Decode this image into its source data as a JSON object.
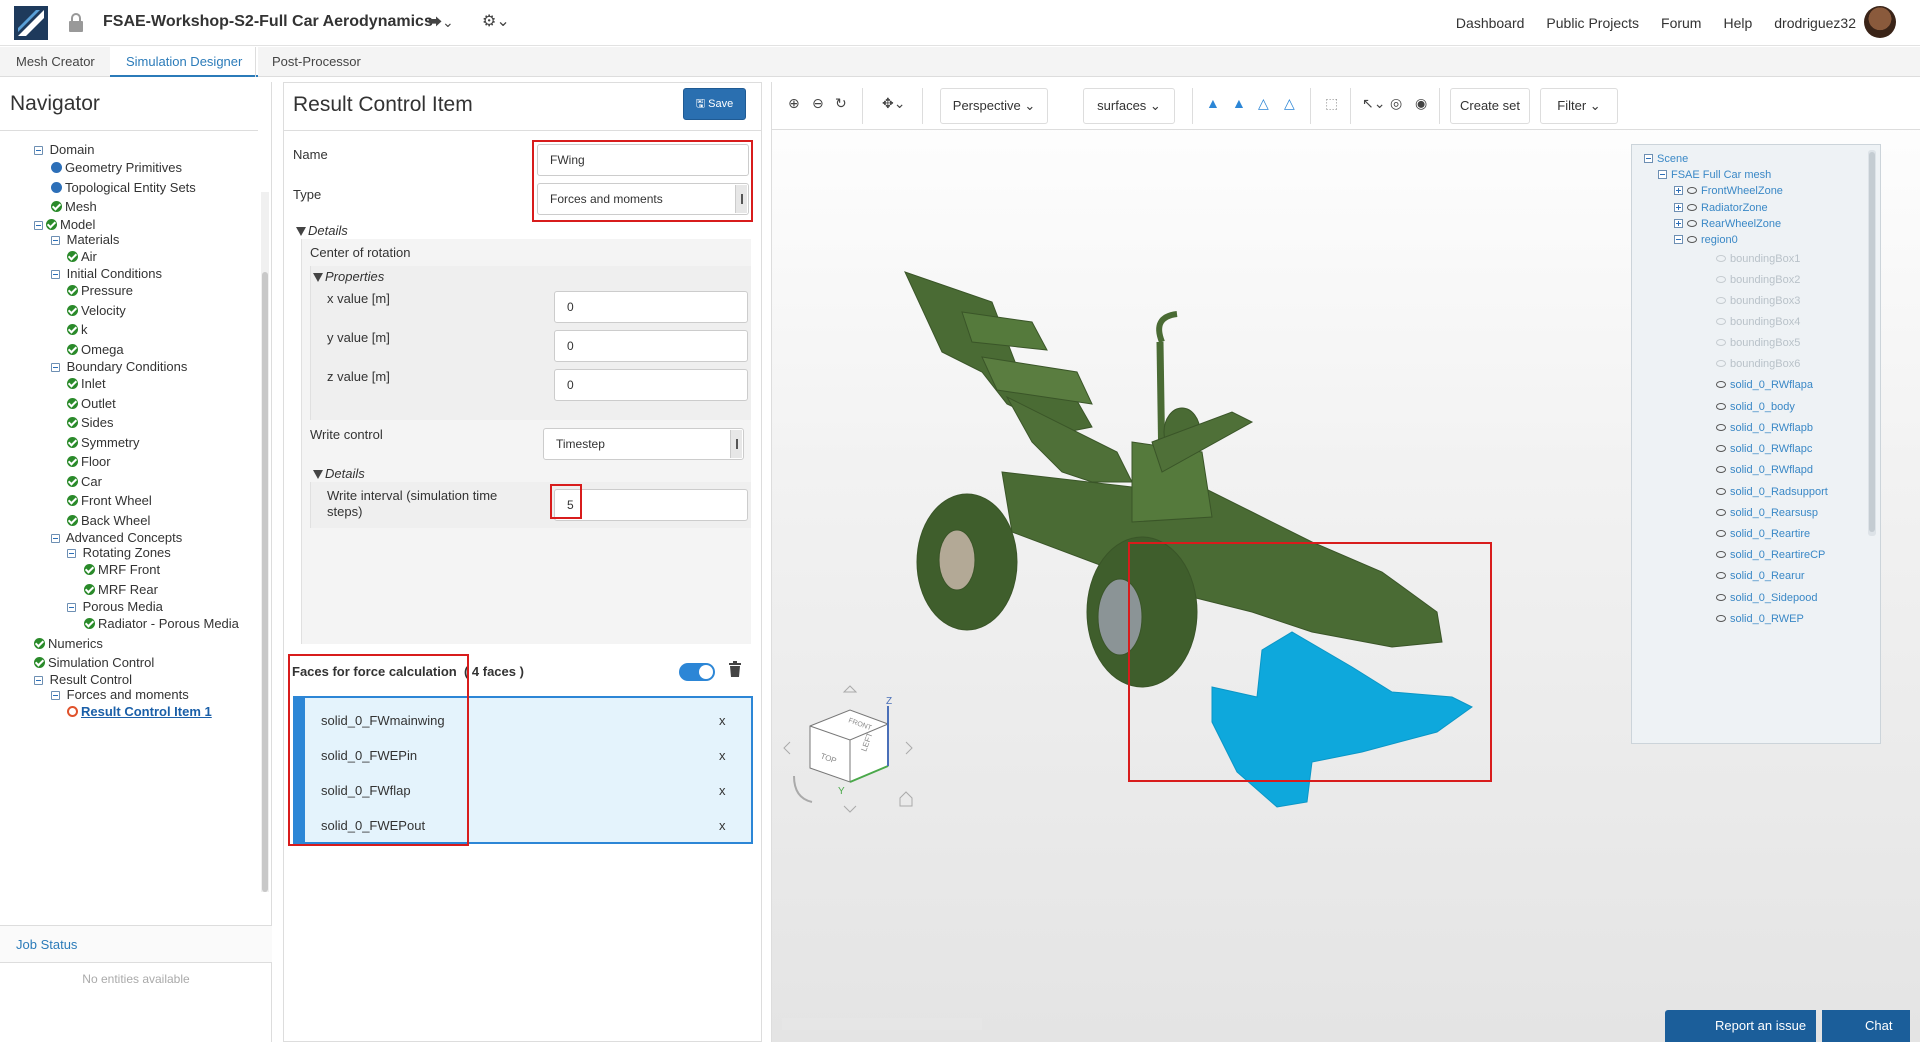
{
  "topbar": {
    "project_title": "FSAE-Workshop-S2-Full Car Aerodynamics",
    "nav": [
      "Dashboard",
      "Public Projects",
      "Forum",
      "Help",
      "drodriguez32"
    ]
  },
  "tabs": [
    "Mesh Creator",
    "Simulation Designer",
    "Post-Processor"
  ],
  "navigator": {
    "title": "Navigator",
    "items": [
      {
        "label": "Domain",
        "icon": "minus"
      },
      {
        "label": "Geometry Primitives",
        "icon": "dot"
      },
      {
        "label": "Topological Entity Sets",
        "icon": "dot"
      },
      {
        "label": "Mesh",
        "icon": "check"
      },
      {
        "label": "Model",
        "icon": "check"
      },
      {
        "label": "Materials",
        "icon": "minus"
      },
      {
        "label": "Air",
        "icon": "check"
      },
      {
        "label": "Initial Conditions",
        "icon": "minus"
      },
      {
        "label": "Pressure",
        "icon": "check"
      },
      {
        "label": "Velocity",
        "icon": "check"
      },
      {
        "label": "k",
        "icon": "check"
      },
      {
        "label": "Omega",
        "icon": "check"
      },
      {
        "label": "Boundary Conditions",
        "icon": "minus"
      },
      {
        "label": "Inlet",
        "icon": "check"
      },
      {
        "label": "Outlet",
        "icon": "check"
      },
      {
        "label": "Sides",
        "icon": "check"
      },
      {
        "label": "Symmetry",
        "icon": "check"
      },
      {
        "label": "Floor",
        "icon": "check"
      },
      {
        "label": "Car",
        "icon": "check"
      },
      {
        "label": "Front Wheel",
        "icon": "check"
      },
      {
        "label": "Back Wheel",
        "icon": "check"
      },
      {
        "label": "Advanced Concepts",
        "icon": "minus"
      },
      {
        "label": "Rotating Zones",
        "icon": "minus"
      },
      {
        "label": "MRF Front",
        "icon": "check"
      },
      {
        "label": "MRF Rear",
        "icon": "check"
      },
      {
        "label": "Porous Media",
        "icon": "minus"
      },
      {
        "label": "Radiator - Porous Media",
        "icon": "check"
      },
      {
        "label": "Numerics",
        "icon": "check"
      },
      {
        "label": "Simulation Control",
        "icon": "check"
      },
      {
        "label": "Result Control",
        "icon": "minus"
      },
      {
        "label": "Forces and moments",
        "icon": "minus"
      },
      {
        "label": "Result Control Item 1",
        "icon": "ring"
      }
    ],
    "job_status": "Job Status",
    "job_empty": "No entities available"
  },
  "result_control": {
    "title": "Result Control Item",
    "save_label": "Save",
    "name_label": "Name",
    "name_value": "FWing",
    "type_label": "Type",
    "type_value": "Forces and moments",
    "details_label": "Details",
    "center_label": "Center of rotation",
    "properties_label": "Properties",
    "x_label": "x value [m]",
    "x_value": "0",
    "y_label": "y value [m]",
    "y_value": "0",
    "z_label": "z value [m]",
    "z_value": "0",
    "write_control_label": "Write control",
    "write_control_value": "Timestep",
    "details2_label": "Details",
    "write_interval_label": "Write interval (simulation time steps)",
    "write_interval_value": "5",
    "faces_title": "Faces for force calculation",
    "faces_count": "( 4 faces )",
    "faces": [
      "solid_0_FWmainwing",
      "solid_0_FWEPin",
      "solid_0_FWflap",
      "solid_0_FWEPout"
    ],
    "remove_label": "x"
  },
  "viewer": {
    "perspective_label": "Perspective",
    "surfaces_label": "surfaces",
    "create_set_label": "Create set",
    "filter_label": "Filter",
    "report_label": "Report an issue",
    "chat_label": "Chat",
    "scene_tree": [
      {
        "label": "Scene",
        "toggle": "minus"
      },
      {
        "label": "FSAE Full Car mesh",
        "toggle": "minus"
      },
      {
        "label": "FrontWheelZone",
        "toggle": "plus"
      },
      {
        "label": "RadiatorZone",
        "toggle": "plus"
      },
      {
        "label": "RearWheelZone",
        "toggle": "plus"
      },
      {
        "label": "region0",
        "toggle": "minus"
      },
      {
        "label": "boundingBox1",
        "dim": true
      },
      {
        "label": "boundingBox2",
        "dim": true
      },
      {
        "label": "boundingBox3",
        "dim": true
      },
      {
        "label": "boundingBox4",
        "dim": true
      },
      {
        "label": "boundingBox5",
        "dim": true
      },
      {
        "label": "boundingBox6",
        "dim": true
      },
      {
        "label": "solid_0_RWflapa"
      },
      {
        "label": "solid_0_body"
      },
      {
        "label": "solid_0_RWflapb"
      },
      {
        "label": "solid_0_RWflapc"
      },
      {
        "label": "solid_0_RWflapd"
      },
      {
        "label": "solid_0_Radsupport"
      },
      {
        "label": "solid_0_Rearsusp"
      },
      {
        "label": "solid_0_Reartire"
      },
      {
        "label": "solid_0_ReartireCP"
      },
      {
        "label": "solid_0_Rearur"
      },
      {
        "label": "solid_0_Sidepood"
      },
      {
        "label": "solid_0_RWEP"
      }
    ],
    "cube_labels": {
      "front": "FRONT",
      "top": "TOP",
      "left": "LEFT",
      "axis_z": "Z",
      "axis_y": "Y"
    },
    "colors": {
      "car": "#4a6b34",
      "selected": "#0ea8dc",
      "highlight": "#d81c1c"
    }
  }
}
